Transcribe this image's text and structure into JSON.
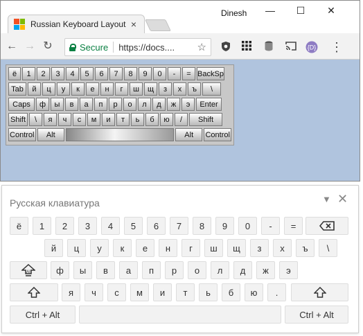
{
  "browser": {
    "tab_title": "Russian Keyboard Layout",
    "tab_close": "×",
    "user_name": "Dinesh",
    "window_minimize": "—",
    "window_maximize": "☐",
    "window_close": "✕",
    "back": "←",
    "forward": "→",
    "reload": "↻",
    "secure_label": "Secure",
    "url": "https://docs....",
    "bookmark_star": "☆",
    "menu_dots": "⋮"
  },
  "virtual_keyboard": {
    "rows": [
      [
        "ё",
        "1",
        "2",
        "3",
        "4",
        "5",
        "6",
        "7",
        "8",
        "9",
        "0",
        "-",
        "=",
        "BackSp"
      ],
      [
        "Tab",
        "й",
        "ц",
        "у",
        "к",
        "е",
        "н",
        "г",
        "ш",
        "щ",
        "з",
        "х",
        "ъ",
        "\\"
      ],
      [
        "Caps",
        "ф",
        "ы",
        "в",
        "а",
        "п",
        "р",
        "о",
        "л",
        "д",
        "ж",
        "э",
        "Enter"
      ],
      [
        "Shift",
        "\\",
        "я",
        "ч",
        "с",
        "м",
        "и",
        "т",
        "ь",
        "б",
        "ю",
        "/",
        "Shift"
      ],
      [
        "Control",
        "Alt",
        "",
        "Alt",
        "Control"
      ]
    ]
  },
  "screen_keyboard": {
    "title": "Русская клавиатура",
    "minimize": "▼",
    "close": "✕",
    "row1": [
      "ё",
      "1",
      "2",
      "3",
      "4",
      "5",
      "6",
      "7",
      "8",
      "9",
      "0",
      "-",
      "="
    ],
    "row2": [
      "й",
      "ц",
      "у",
      "к",
      "е",
      "н",
      "г",
      "ш",
      "щ",
      "з",
      "х",
      "ъ",
      "\\"
    ],
    "row3": [
      "ф",
      "ы",
      "в",
      "а",
      "п",
      "р",
      "о",
      "л",
      "д",
      "ж",
      "э"
    ],
    "row4": [
      "я",
      "ч",
      "с",
      "м",
      "и",
      "т",
      "ь",
      "б",
      "ю",
      "."
    ],
    "ctrl_alt_left": "Ctrl + Alt",
    "ctrl_alt_right": "Ctrl + Alt"
  },
  "icons": {
    "backspace": "backspace-icon",
    "caps": "caps-lock-icon",
    "shift": "shift-icon"
  },
  "colors": {
    "page_background": "#b0c4de",
    "secure_green": "#0b8043"
  }
}
